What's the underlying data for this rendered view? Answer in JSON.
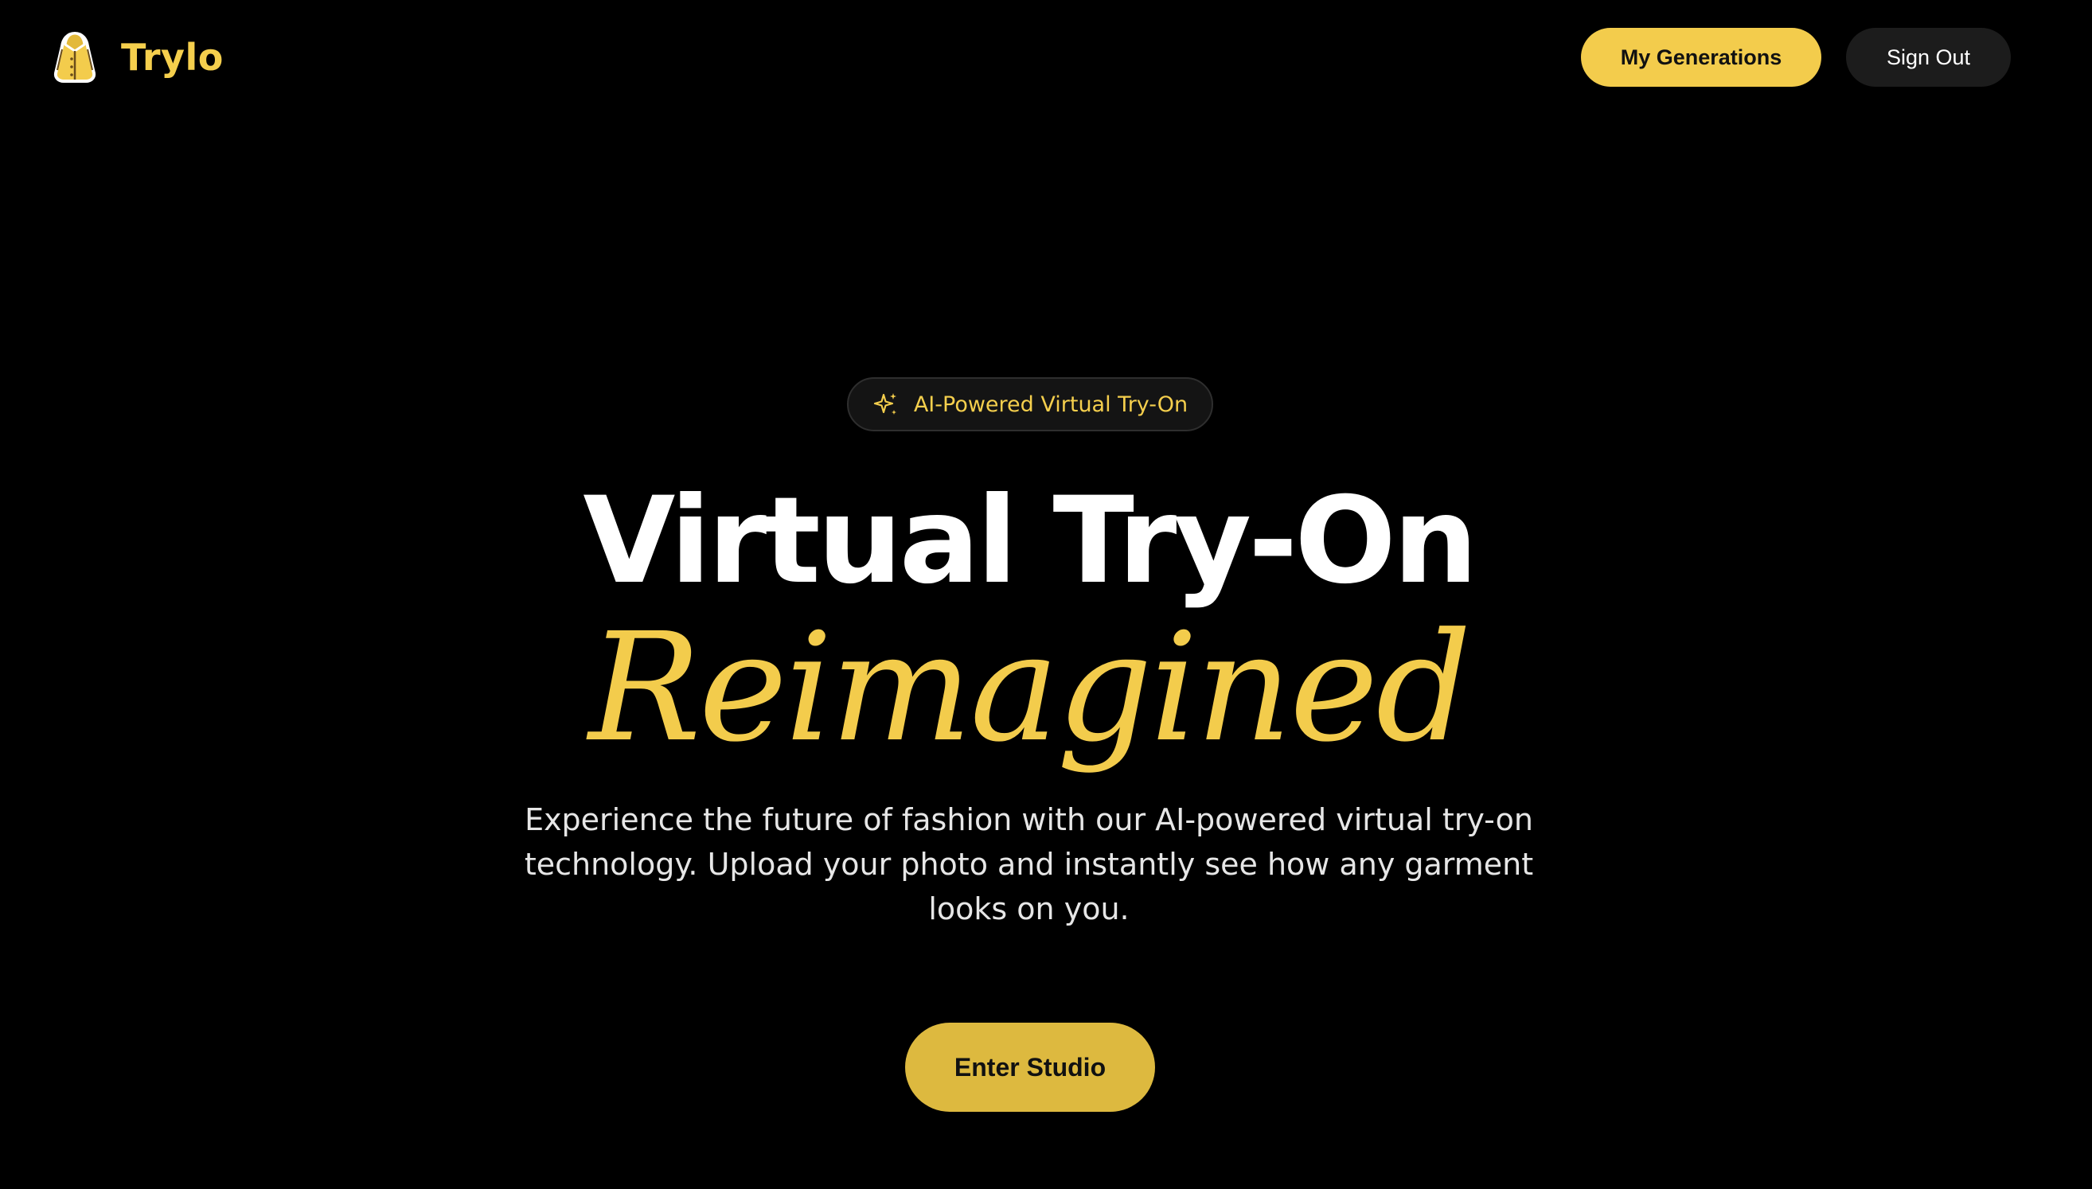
{
  "header": {
    "logo_icon": "raincoat-icon",
    "brand_name": "Trylo",
    "my_generations_label": "My Generations",
    "sign_out_label": "Sign Out"
  },
  "hero": {
    "badge_icon": "sparkles-icon",
    "badge_text": "AI-Powered Virtual Try-On",
    "title_line1": "Virtual Try-On",
    "title_line2": "Reimagined",
    "description": "Experience the future of fashion with our AI-powered virtual try-on technology. Upload your photo and instantly see how any garment looks on you.",
    "cta_label": "Enter Studio"
  },
  "colors": {
    "background": "#000000",
    "accent": "#f3cc4c",
    "cta": "#ddb93f",
    "secondary_button": "#1c1c1c",
    "text": "#ffffff"
  }
}
